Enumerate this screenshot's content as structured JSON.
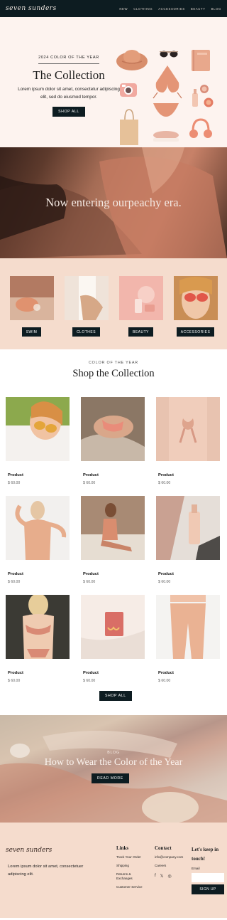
{
  "nav": {
    "logo": "seven sunders",
    "links": [
      "NEW",
      "CLOTHING",
      "ACCESSORIES",
      "BEAUTY",
      "BLOG"
    ]
  },
  "hero": {
    "eyebrow": "2024 COLOR OF THE YEAR",
    "title": "The Collection",
    "subtitle": "Lorem ipsum dolor sit amet, consectetur adipiscing elit, sed do eiusmod tempor.",
    "button": "SHOP ALL"
  },
  "banner": {
    "text": "Now entering ourpeachy era."
  },
  "categories": [
    {
      "label": "SWIM"
    },
    {
      "label": "CLOTHES"
    },
    {
      "label": "BEAUTY"
    },
    {
      "label": "ACCESSORIES"
    }
  ],
  "shop": {
    "eyebrow": "COLOR OF THE YEAR",
    "title": "Shop the Collection",
    "products": [
      {
        "name": "Product",
        "price": "$ 60.00"
      },
      {
        "name": "Product",
        "price": "$ 60.00"
      },
      {
        "name": "Product",
        "price": "$ 60.00"
      },
      {
        "name": "Product",
        "price": "$ 60.00"
      },
      {
        "name": "Product",
        "price": "$ 60.00"
      },
      {
        "name": "Product",
        "price": "$ 60.00"
      },
      {
        "name": "Product",
        "price": "$ 60.00"
      },
      {
        "name": "Product",
        "price": "$ 60.00"
      },
      {
        "name": "Product",
        "price": "$ 60.00"
      }
    ],
    "button": "SHOP ALL"
  },
  "blog": {
    "eyebrow": "BLOG",
    "title": "How to Wear the Color of the Year",
    "button": "READ MORE"
  },
  "footer": {
    "logo": "seven sunders",
    "text": "Lorem ipsum dolor sit amet, consectetuer adipiscing elit.",
    "links_heading": "Links",
    "links": [
      "Track Your Order",
      "Shipping",
      "Returns & Exchanges",
      "Customer Service"
    ],
    "contact_heading": "Contact",
    "contact": [
      "info@company.com",
      "Careers"
    ],
    "social_icons": [
      "facebook-icon",
      "x-icon",
      "instagram-icon"
    ],
    "newsletter_heading": "Let's keep in touch!",
    "email_label": "Email",
    "signup_button": "SIGN UP"
  },
  "colors": {
    "dark": "#0d1c21",
    "blush": "#fdf3ef",
    "peach": "#f5dccd",
    "accent": "#d9826a"
  }
}
